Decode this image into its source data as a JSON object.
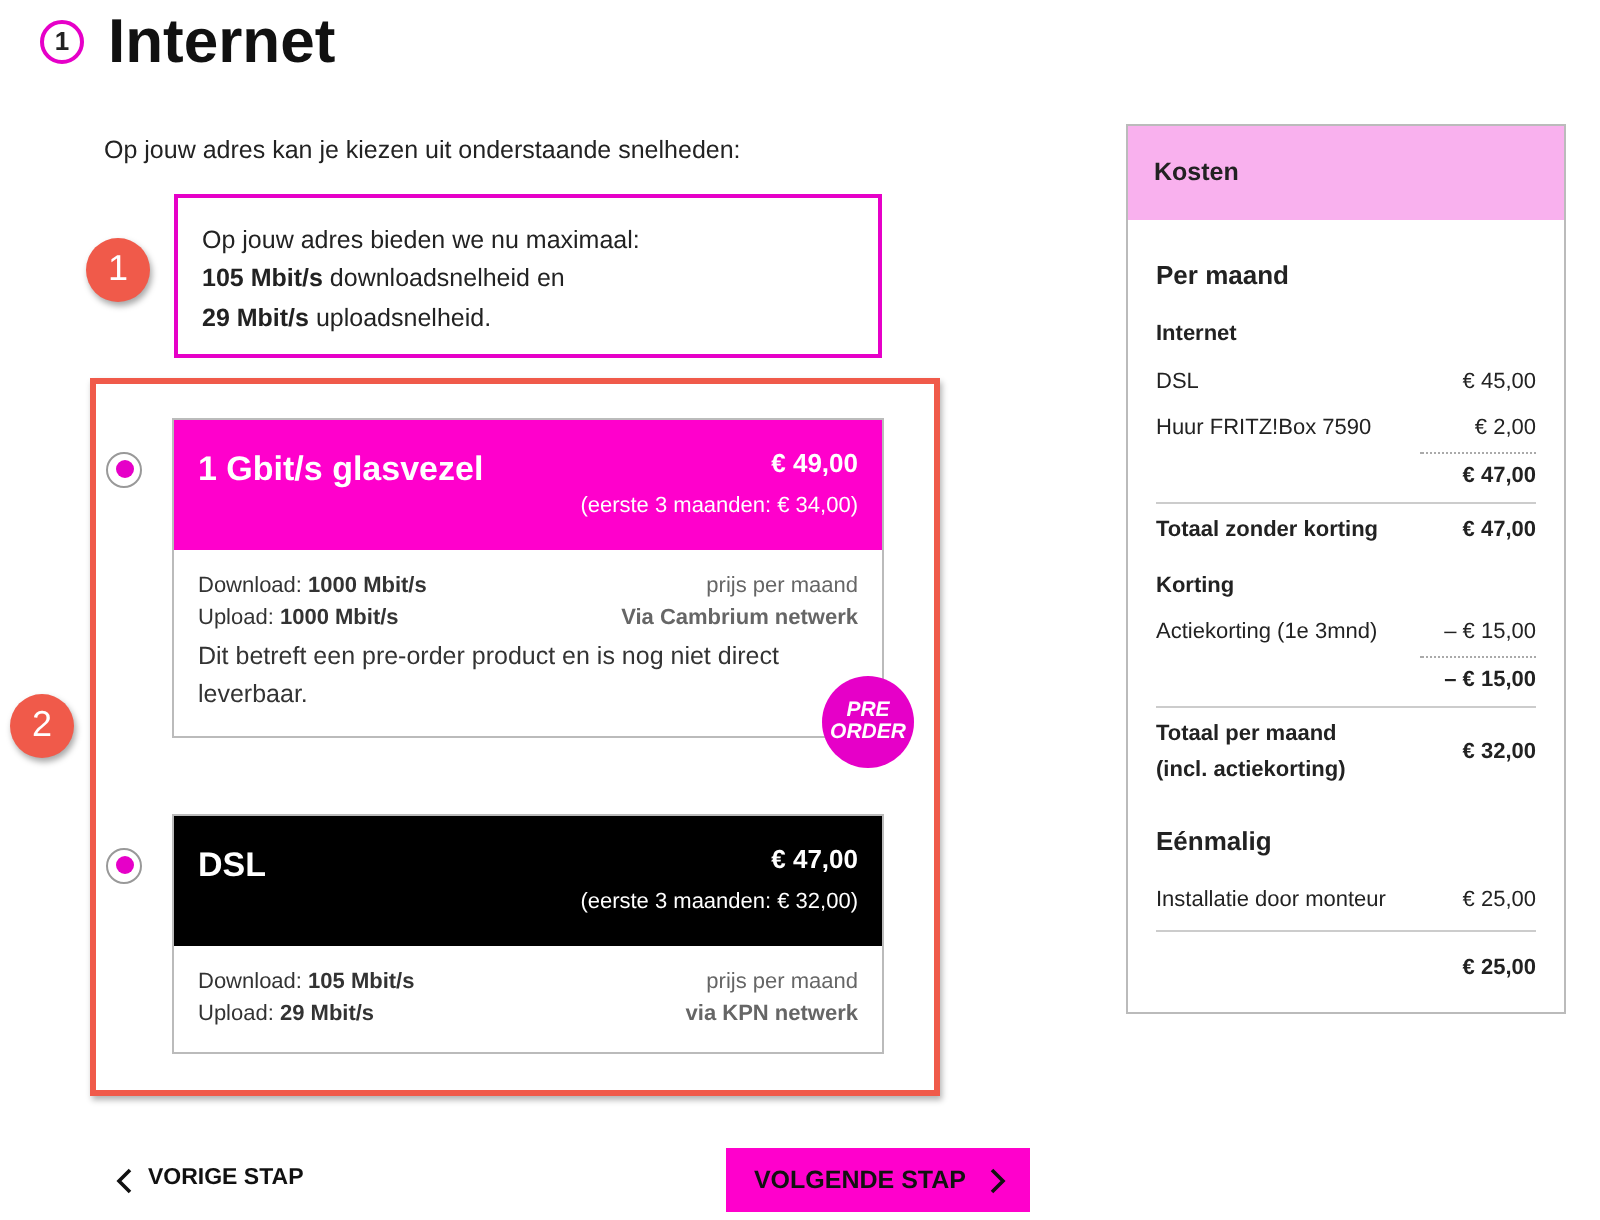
{
  "step": "1",
  "title": "Internet",
  "intro": "Op jouw adres kan je kiezen uit onderstaande snelheden:",
  "max_box": {
    "lines": [
      "Op jouw adres bieden we nu maximaal:",
      "**105 Mbit/s** downloadsnelheid en",
      "**29 Mbit/s** uploadsnelheid."
    ]
  },
  "annotations": [
    {
      "label": "1"
    },
    {
      "label": "2"
    }
  ],
  "options": [
    {
      "name": "1 Gbit/s glasvezel",
      "price": "€ 49,00",
      "promo": "(eerste 3 maanden: € 34,00)",
      "color": "#ff00cc",
      "selected": true,
      "download_label": "Download:",
      "download": "1000 Mbit/s",
      "upload_label": "Upload:",
      "upload": "1000 Mbit/s",
      "price_note": "prijs per maand",
      "network": "Via Cambrium netwerk",
      "note": "Dit betreft een pre-order product en is nog niet direct leverbaar.",
      "badge": "PRE ORDER"
    },
    {
      "name": "DSL",
      "price": "€ 47,00",
      "promo": "(eerste 3 maanden: € 32,00)",
      "color": "#000000",
      "selected": true,
      "download_label": "Download:",
      "download": "105 Mbit/s",
      "upload_label": "Upload:",
      "upload": "29 Mbit/s",
      "price_note": "prijs per maand",
      "network": "via KPN netwerk"
    }
  ],
  "costs": {
    "title": "Kosten",
    "sections": [
      {
        "title": "Per maand",
        "rows": [
          {
            "kind": "group",
            "label": "Internet"
          },
          {
            "kind": "item",
            "label": "DSL",
            "amount": "€ 45,00"
          },
          {
            "kind": "item",
            "label": "Huur FRITZ!Box 7590",
            "amount": "€ 2,00"
          },
          {
            "kind": "subtotal",
            "amount": "€ 47,00"
          },
          {
            "kind": "total",
            "label": "Totaal zonder korting",
            "amount": "€ 47,00"
          },
          {
            "kind": "group",
            "label": "Korting"
          },
          {
            "kind": "item",
            "label": "Actiekorting (1e 3mnd)",
            "amount": "– € 15,00"
          },
          {
            "kind": "subtotal",
            "amount": "– € 15,00"
          },
          {
            "kind": "total",
            "label": "Totaal per maand\n(incl. actiekorting)",
            "amount": "€ 32,00"
          }
        ]
      },
      {
        "title": "Eénmalig",
        "rows": [
          {
            "kind": "item",
            "label": "Installatie door monteur",
            "amount": "€ 25,00"
          },
          {
            "kind": "sum",
            "amount": "€ 25,00"
          }
        ]
      }
    ]
  },
  "nav": {
    "back": "VORIGE STAP",
    "next": "VOLGENDE STAP"
  }
}
